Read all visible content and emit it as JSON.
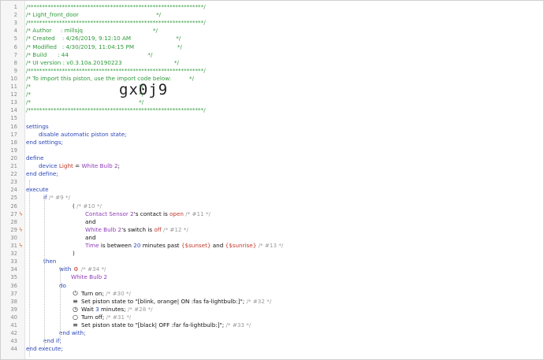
{
  "header_lines": [
    "/**************************************************************/",
    "/* Light_front_door                                           */",
    "/**************************************************************/",
    "/* Author     : millsjq                                       */",
    "/* Created    : 4/26/2019, 9:12:10 AM                         */",
    "/* Modified   : 4/30/2019, 11:04:15 PM                        */",
    "/* Build      : 44                                            */",
    "/* UI version : v0.3.10a.20190223                             */",
    "/**************************************************************/",
    "/* To import this piston, use the import code below:          */",
    "/*                                                            */",
    "/*                                                            */",
    "/*                                                            */",
    "/**************************************************************/"
  ],
  "import_code": "gx0j9",
  "settings": {
    "keyword": "settings",
    "line": "disable automatic piston state;",
    "end": "end settings;"
  },
  "define": {
    "keyword": "define",
    "device_kw": "device",
    "var_name": "Light",
    "equals": "=",
    "device_value": "White Bulb 2",
    "semicolon": ";",
    "end": "end define;"
  },
  "execute": {
    "keyword": "execute",
    "if_kw": "if",
    "if_comment": "/* #9 */",
    "paren_open": "(",
    "paren_comment": "/* #10 */",
    "cond1": {
      "device": "Contact Sensor 2",
      "possessive": "'s",
      "attr": "contact",
      "is": "is",
      "value": "open",
      "comment": "/* #11 */"
    },
    "and1": "and",
    "cond2": {
      "device": "White Bulb 2",
      "possessive": "'s",
      "attr": "switch",
      "is": "is",
      "value": "off",
      "comment": "/* #12 */"
    },
    "and2": "and",
    "cond3": {
      "subject": "Time",
      "text1": "is between",
      "num": "20",
      "text2": "minutes past",
      "start": "{$sunset}",
      "and": "and",
      "end": "{$sunrise}",
      "comment": "/* #13 */"
    },
    "paren_close": ")",
    "then_kw": "then",
    "with_kw": "with",
    "with_comment": "/* #34 */",
    "with_device": "White Bulb 2",
    "do_kw": "do",
    "tasks": [
      {
        "icon": "power-icon",
        "glyph": "⏻",
        "text": "Turn on;",
        "comment": "/* #30 */"
      },
      {
        "icon": "list-icon",
        "glyph": "≡",
        "text": "Set piston state to \"[blink, orange| ON :fas fa-lightbulb:]\";",
        "comment": "/* #32 */"
      },
      {
        "icon": "clock-icon",
        "glyph": "◷",
        "text_pre": "Wait",
        "num": "3",
        "text_post": "minutes;",
        "comment": "/* #28 */"
      },
      {
        "icon": "power-off-icon",
        "glyph": "○",
        "text": "Turn off;",
        "comment": "/* #31 */"
      },
      {
        "icon": "list-icon",
        "glyph": "≡",
        "text": "Set piston state to \"[black| OFF :far fa-lightbulb:]\";",
        "comment": "/* #33 */"
      }
    ],
    "end_with": "end with;",
    "end_if": "end if;",
    "end": "end execute;"
  },
  "line_numbers": [
    "1",
    "2",
    "3",
    "4",
    "5",
    "6",
    "7",
    "8",
    "9",
    "10",
    "11",
    "12",
    "13",
    "14",
    "15",
    "16",
    "17",
    "18",
    "19",
    "20",
    "21",
    "22",
    "23",
    "24",
    "25",
    "26",
    "27",
    "28",
    "29",
    "30",
    "31",
    "32",
    "33",
    "34",
    "35",
    "36",
    "37",
    "38",
    "39",
    "40",
    "41",
    "42",
    "43",
    "44"
  ],
  "colors": {
    "comment": "#2f9a3a",
    "keyword": "#2a46b8",
    "variable": "#c0392b",
    "device": "#8f3ab8",
    "bolt": "#e0662a"
  }
}
